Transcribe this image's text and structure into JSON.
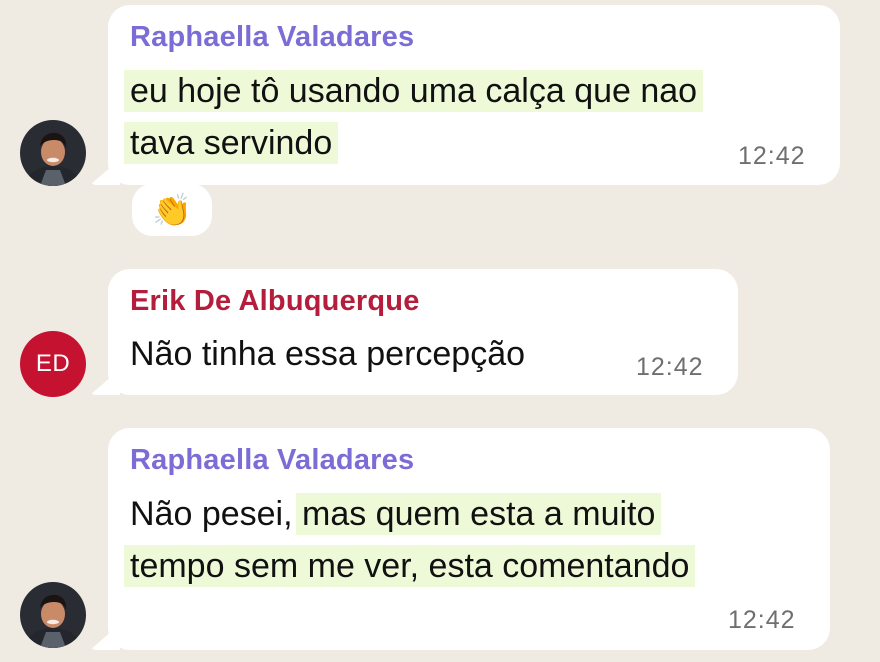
{
  "colors": {
    "background": "#efeae2",
    "bubble": "#ffffff",
    "sender_raphaella": "#7b6cd6",
    "sender_erik": "#b41d3b",
    "highlight": "#eefad7",
    "avatar_ed": "#c41230"
  },
  "messages": [
    {
      "sender": "Raphaella Valadares",
      "lines": [
        "eu hoje tô usando uma calça que nao",
        "tava servindo"
      ],
      "time": "12:42",
      "reaction": "👏",
      "avatar": "photo"
    },
    {
      "sender": "Erik De Albuquerque",
      "text": "Não tinha essa percepção",
      "time": "12:42",
      "avatar_initials": "ED"
    },
    {
      "sender": "Raphaella Valadares",
      "line1_plain": "Não pesei, ",
      "line1_highlight": "mas quem esta a muito",
      "line2": "tempo sem me ver, esta comentando",
      "time": "12:42",
      "avatar": "photo"
    }
  ]
}
